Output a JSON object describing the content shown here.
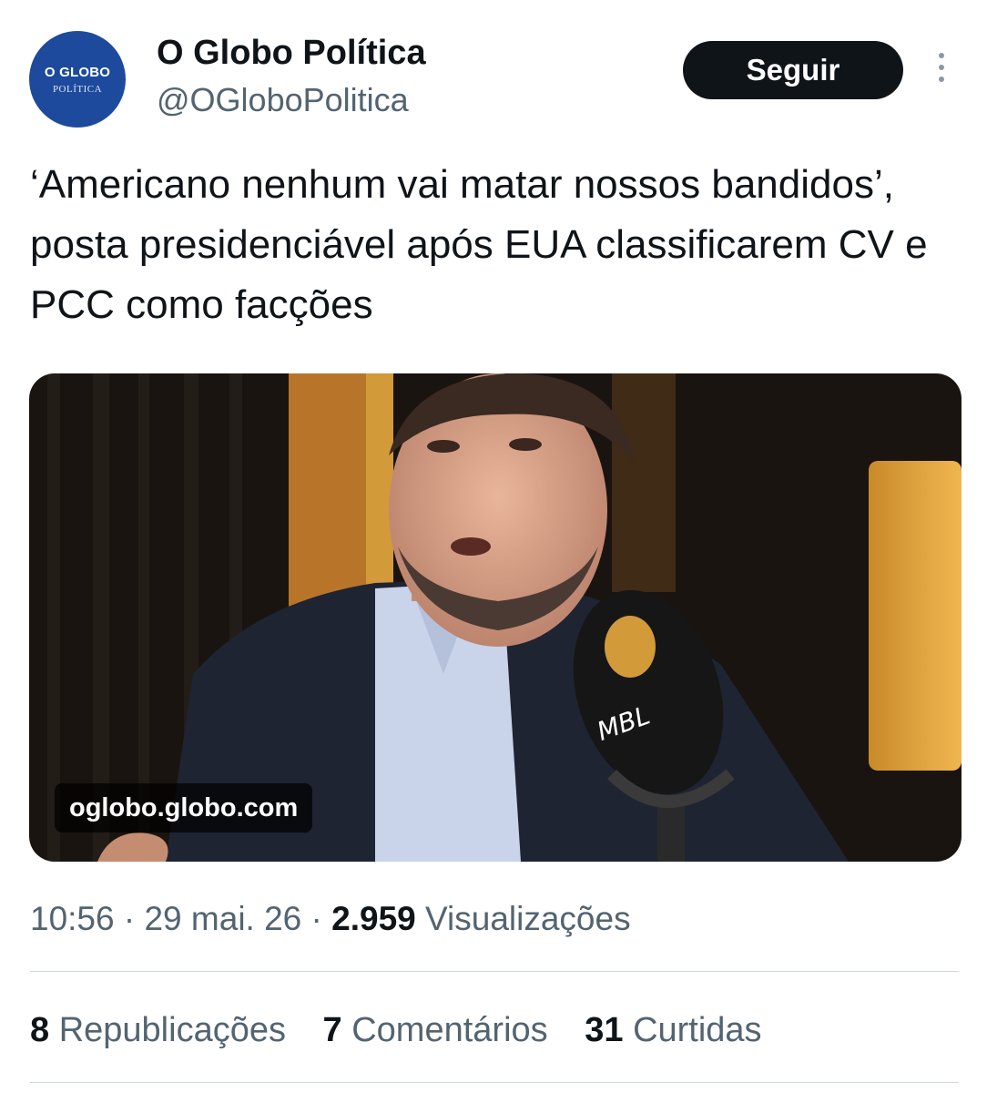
{
  "account": {
    "avatar_line1": "O GLOBO",
    "avatar_line2": "POLÍTICA",
    "name": "O Globo Política",
    "handle": "@OGloboPolitica",
    "follow_label": "Seguir"
  },
  "tweet": {
    "text": "‘Americano nenhum vai matar nossos bandidos’, posta presidenciável após EUA classificarem CV e PCC como facções",
    "link_domain": "oglobo.globo.com",
    "time": "10:56",
    "separator": "·",
    "date": "29 mai. 26",
    "views_count": "2.959",
    "views_label": "Visualizações"
  },
  "stats": {
    "reposts_count": "8",
    "reposts_label": "Republicações",
    "comments_count": "7",
    "comments_label": "Comentários",
    "likes_count": "31",
    "likes_label": "Curtidas"
  },
  "media": {
    "mic_brand": "MBL"
  },
  "colors": {
    "avatar_bg": "#1d4a9c",
    "button_bg": "#0f1419",
    "secondary_text": "#536471"
  }
}
